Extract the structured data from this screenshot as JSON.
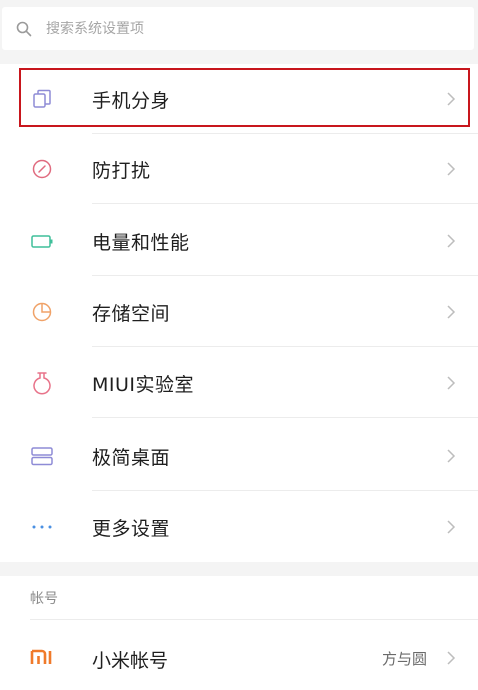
{
  "search": {
    "placeholder": "搜索系统设置项"
  },
  "settings": {
    "items": [
      {
        "label": "手机分身",
        "icon": "dual-apps-icon",
        "color": "#8e8bd6"
      },
      {
        "label": "防打扰",
        "icon": "do-not-disturb-icon",
        "color": "#e06b7f"
      },
      {
        "label": "电量和性能",
        "icon": "battery-icon",
        "color": "#3fbf9a"
      },
      {
        "label": "存储空间",
        "icon": "storage-pie-icon",
        "color": "#f0a268"
      },
      {
        "label": "MIUI实验室",
        "icon": "lab-flask-icon",
        "color": "#e8738a"
      },
      {
        "label": "极简桌面",
        "icon": "simple-home-icon",
        "color": "#8e8bd6"
      },
      {
        "label": "更多设置",
        "icon": "more-dots-icon",
        "color": "#4a90e2"
      }
    ]
  },
  "account_section": {
    "header": "帐号",
    "item": {
      "label": "小米帐号",
      "icon": "mi-logo-icon",
      "color": "#f07a2a"
    },
    "watermark": "方与圆"
  },
  "highlight_color": "#c8161d"
}
